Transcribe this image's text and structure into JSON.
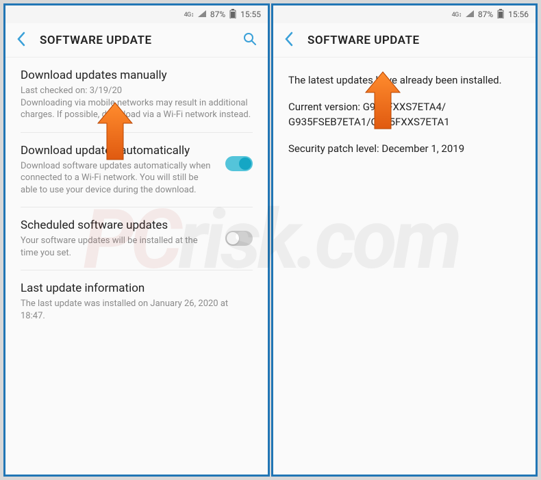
{
  "left": {
    "status": {
      "network": "4G↕",
      "battery_pct": "87%",
      "time": "15:55"
    },
    "header": {
      "title": "SOFTWARE UPDATE"
    },
    "items": {
      "manual": {
        "title": "Download updates manually",
        "desc": "Last checked on: 3/19/20\nDownloading via mobile networks may result in additional charges. If possible, download via a Wi-Fi network instead."
      },
      "auto": {
        "title": "Download updates automatically",
        "desc": "Download software updates automatically when connected to a Wi-Fi network. You will still be able to use your device during the download.",
        "toggle": true
      },
      "scheduled": {
        "title": "Scheduled software updates",
        "desc": "Your software updates will be installed at the time you set.",
        "toggle": false
      },
      "lastinfo": {
        "title": "Last update information",
        "desc": "The last update was installed on January 26, 2020 at 18:47."
      }
    }
  },
  "right": {
    "status": {
      "network": "4G↕",
      "battery_pct": "87%",
      "time": "15:56"
    },
    "header": {
      "title": "SOFTWARE UPDATE"
    },
    "info": {
      "line1": "The latest updates have already been installed.",
      "line2": "Current version: G935FXXS7ETA4/\nG935FSEB7ETA1/G935FXXS7ETA1",
      "line3": "Security patch level: December 1, 2019"
    }
  },
  "watermark": {
    "text1": "PC",
    "text2": "risk.com"
  }
}
